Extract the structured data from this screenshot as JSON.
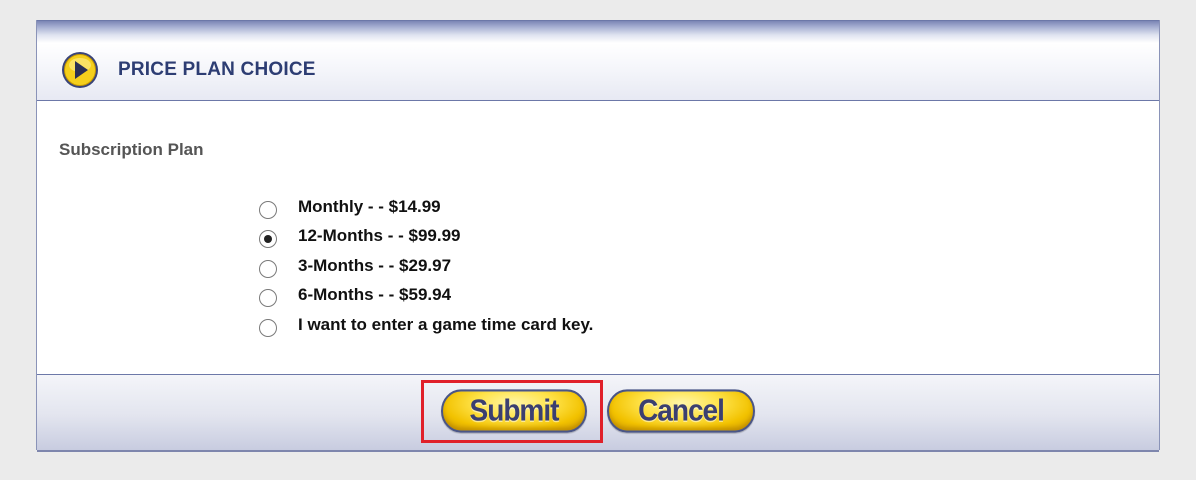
{
  "header": {
    "title": "PRICE PLAN CHOICE",
    "icon": "play-arrow-icon"
  },
  "form": {
    "section_label": "Subscription Plan",
    "options": [
      {
        "label": "Monthly - - $14.99",
        "checked": false
      },
      {
        "label": "12-Months - - $99.99",
        "checked": true
      },
      {
        "label": "3-Months - - $29.97",
        "checked": false
      },
      {
        "label": "6-Months - - $59.94",
        "checked": false
      },
      {
        "label": "I want to enter a game time card key.",
        "checked": false
      }
    ]
  },
  "footer": {
    "submit_label": "Submit",
    "cancel_label": "Cancel"
  },
  "colors": {
    "title": "#2d3d73",
    "button_fill": "#ffe34a",
    "button_text": "#3b3f70",
    "highlight": "#e0202a"
  }
}
